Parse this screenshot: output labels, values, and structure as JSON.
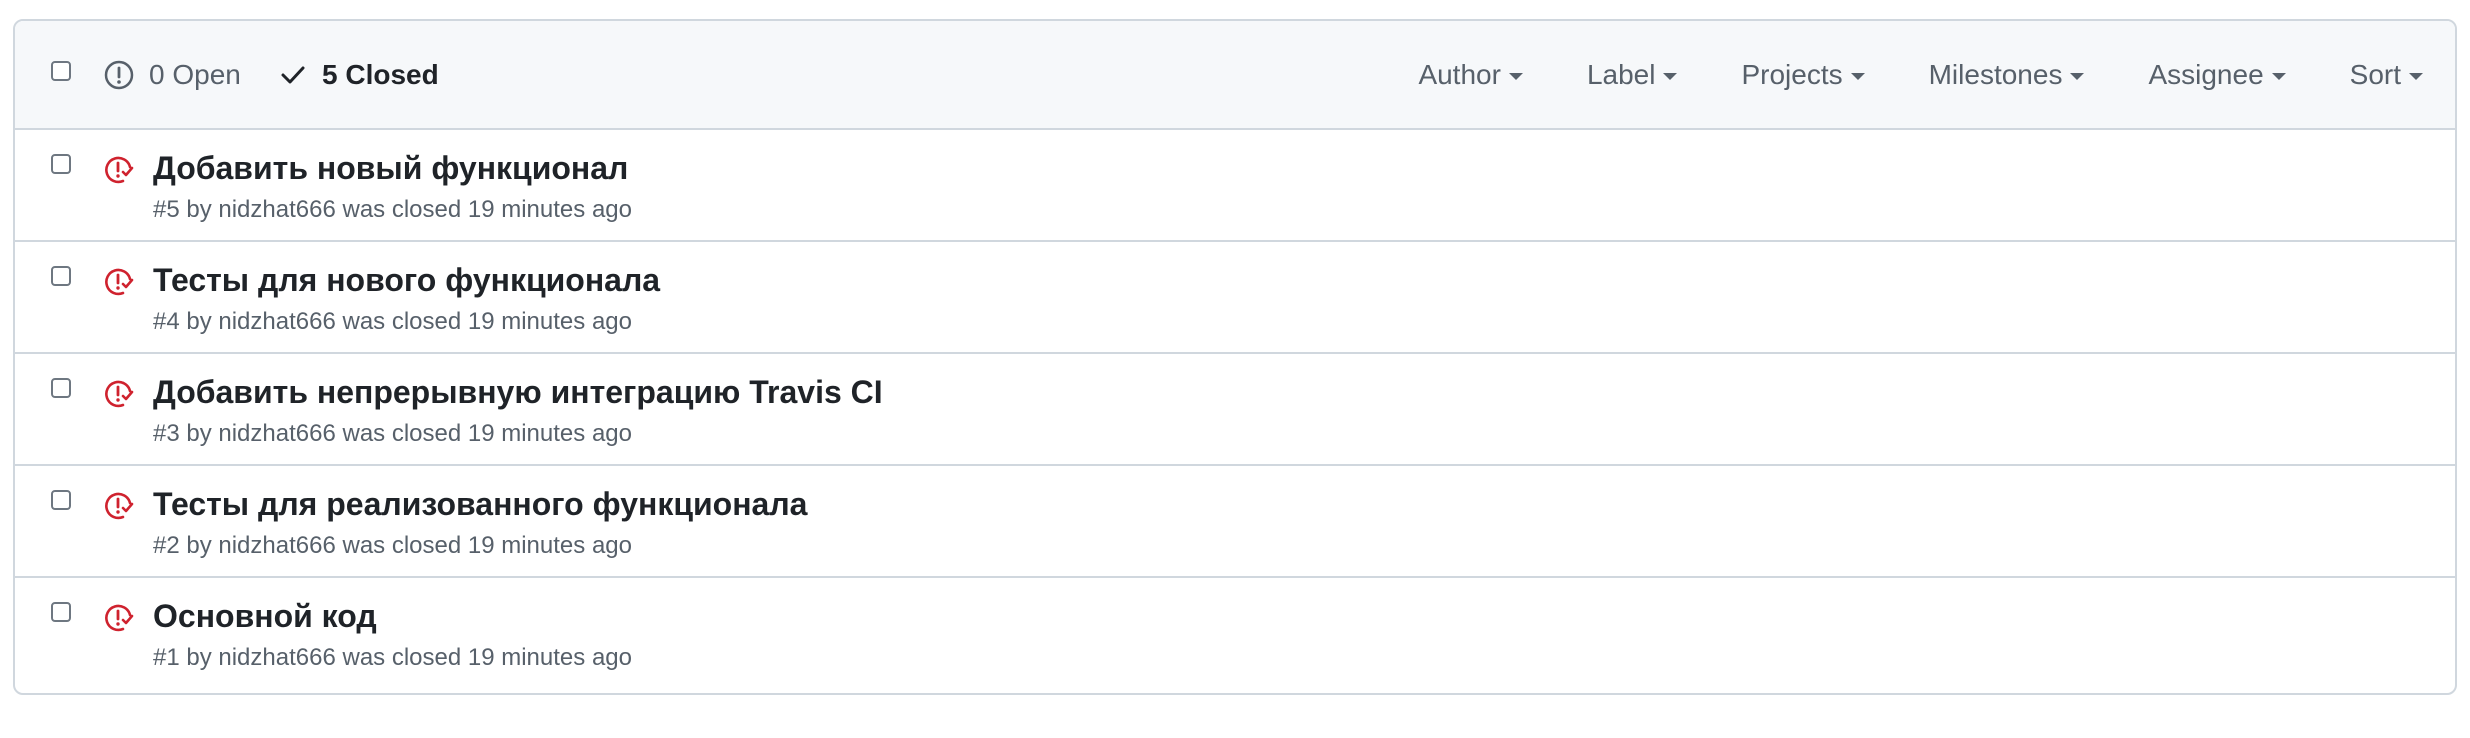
{
  "header": {
    "open_label": "0 Open",
    "closed_label": "5 Closed",
    "filters": [
      "Author",
      "Label",
      "Projects",
      "Milestones",
      "Assignee",
      "Sort"
    ]
  },
  "colors": {
    "closed_issue_icon": "#cf222e",
    "border": "#d0d7de",
    "header_bg": "#f6f8fa",
    "muted_text": "#57606a"
  },
  "issues": [
    {
      "title": "Добавить новый функционал",
      "meta": "#5 by nidzhat666 was closed 19 minutes ago",
      "icon": "issue-closed-not-planned-icon"
    },
    {
      "title": "Тесты для нового функционала",
      "meta": "#4 by nidzhat666 was closed 19 minutes ago",
      "icon": "issue-closed-not-planned-icon"
    },
    {
      "title": "Добавить непрерывную интеграцию Travis CI",
      "meta": "#3 by nidzhat666 was closed 19 minutes ago",
      "icon": "issue-closed-not-planned-icon"
    },
    {
      "title": "Тесты для реализованного функционала",
      "meta": "#2 by nidzhat666 was closed 19 minutes ago",
      "icon": "issue-closed-not-planned-icon"
    },
    {
      "title": "Основной код",
      "meta": "#1 by nidzhat666 was closed 19 minutes ago",
      "icon": "issue-closed-not-planned-icon"
    }
  ]
}
